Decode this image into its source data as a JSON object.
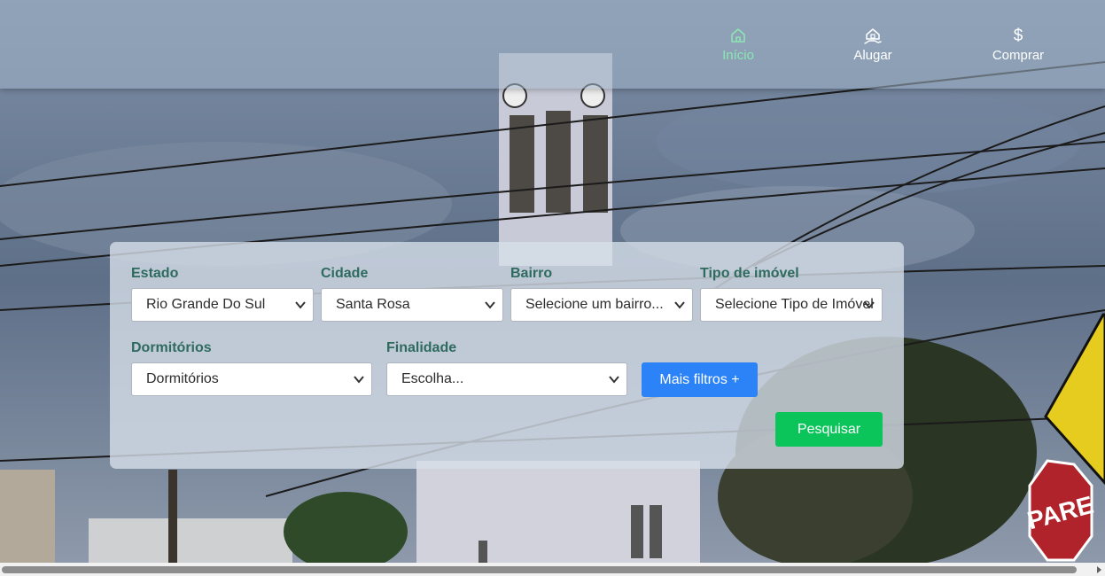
{
  "nav": {
    "items": [
      {
        "label": "Início",
        "icon": "home-icon",
        "active": true
      },
      {
        "label": "Alugar",
        "icon": "rent-house-hand-icon",
        "active": false
      },
      {
        "label": "Comprar",
        "icon": "dollar-icon",
        "active": false
      }
    ],
    "dollar_glyph": "$"
  },
  "search": {
    "estado": {
      "label": "Estado",
      "value": "Rio Grande Do Sul"
    },
    "cidade": {
      "label": "Cidade",
      "value": "Santa Rosa"
    },
    "bairro": {
      "label": "Bairro",
      "value": "Selecione um bairro..."
    },
    "tipo": {
      "label": "Tipo de imóvel",
      "value": "Selecione Tipo de Imóvel"
    },
    "dormitorios": {
      "label": "Dormitórios",
      "value": "Dormitórios"
    },
    "finalidade": {
      "label": "Finalidade",
      "value": "Escolha..."
    },
    "more_filters_label": "Mais filtros +",
    "search_label": "Pesquisar"
  },
  "background": {
    "sign_text": "PARE"
  },
  "colors": {
    "accent_green": "#0bc55a",
    "accent_blue": "#2c83f8",
    "label_green": "#2e6b5e",
    "active_nav": "#8be6b4"
  }
}
